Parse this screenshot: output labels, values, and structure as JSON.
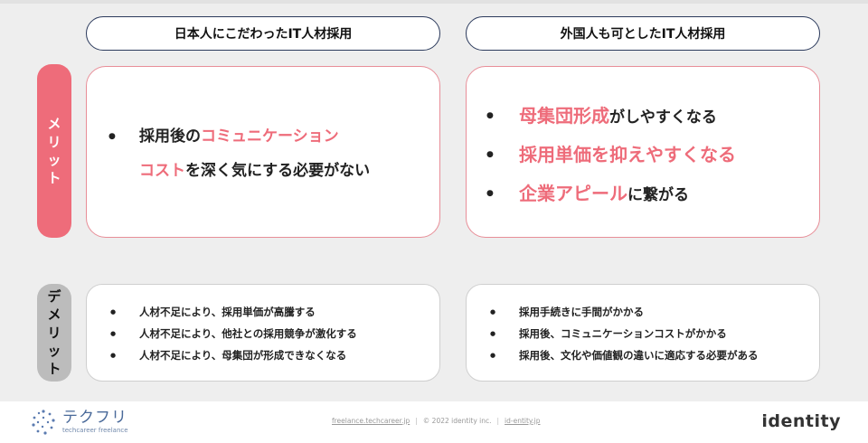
{
  "headers": {
    "left": "日本人にこだわったIT人材採用",
    "right": "外国人も可としたIT人材採用"
  },
  "labels": {
    "merit": [
      "メ",
      "リ",
      "ッ",
      "ト"
    ],
    "demerit": [
      "デ",
      "メ",
      "リ",
      "ッ",
      "ト"
    ]
  },
  "merit_left": {
    "hl1": "コミュニケーション",
    "pre1": "採用後の",
    "hl2": "コスト",
    "post2": "を深く気にする必要がない"
  },
  "merit_right": [
    {
      "hl": "母集団形成",
      "rest": "がしやすくなる"
    },
    {
      "hl": "採用単価を抑えやすくなる",
      "rest": ""
    },
    {
      "hl": "企業アピール",
      "rest": "に繋がる"
    }
  ],
  "demerit_left": [
    "人材不足により、採用単価が高騰する",
    "人材不足により、他社との採用競争が激化する",
    "人材不足により、母集団が形成できなくなる"
  ],
  "demerit_right": [
    "採用手続きに手間がかかる",
    "採用後、コミュニケーションコストがかかる",
    "採用後、文化や価値観の違いに適応する必要がある"
  ],
  "footer": {
    "logo_main": "テクフリ",
    "logo_sub": "techcareer freelance",
    "link1": "freelance.techcareer.jp",
    "copyright": "© 2022 identity inc.",
    "link2": "id-entity.jp",
    "brand": "identity"
  },
  "colors": {
    "accent": "#ee6c7a",
    "navy": "#2b3a5c",
    "gray_label": "#bcbcbc"
  }
}
